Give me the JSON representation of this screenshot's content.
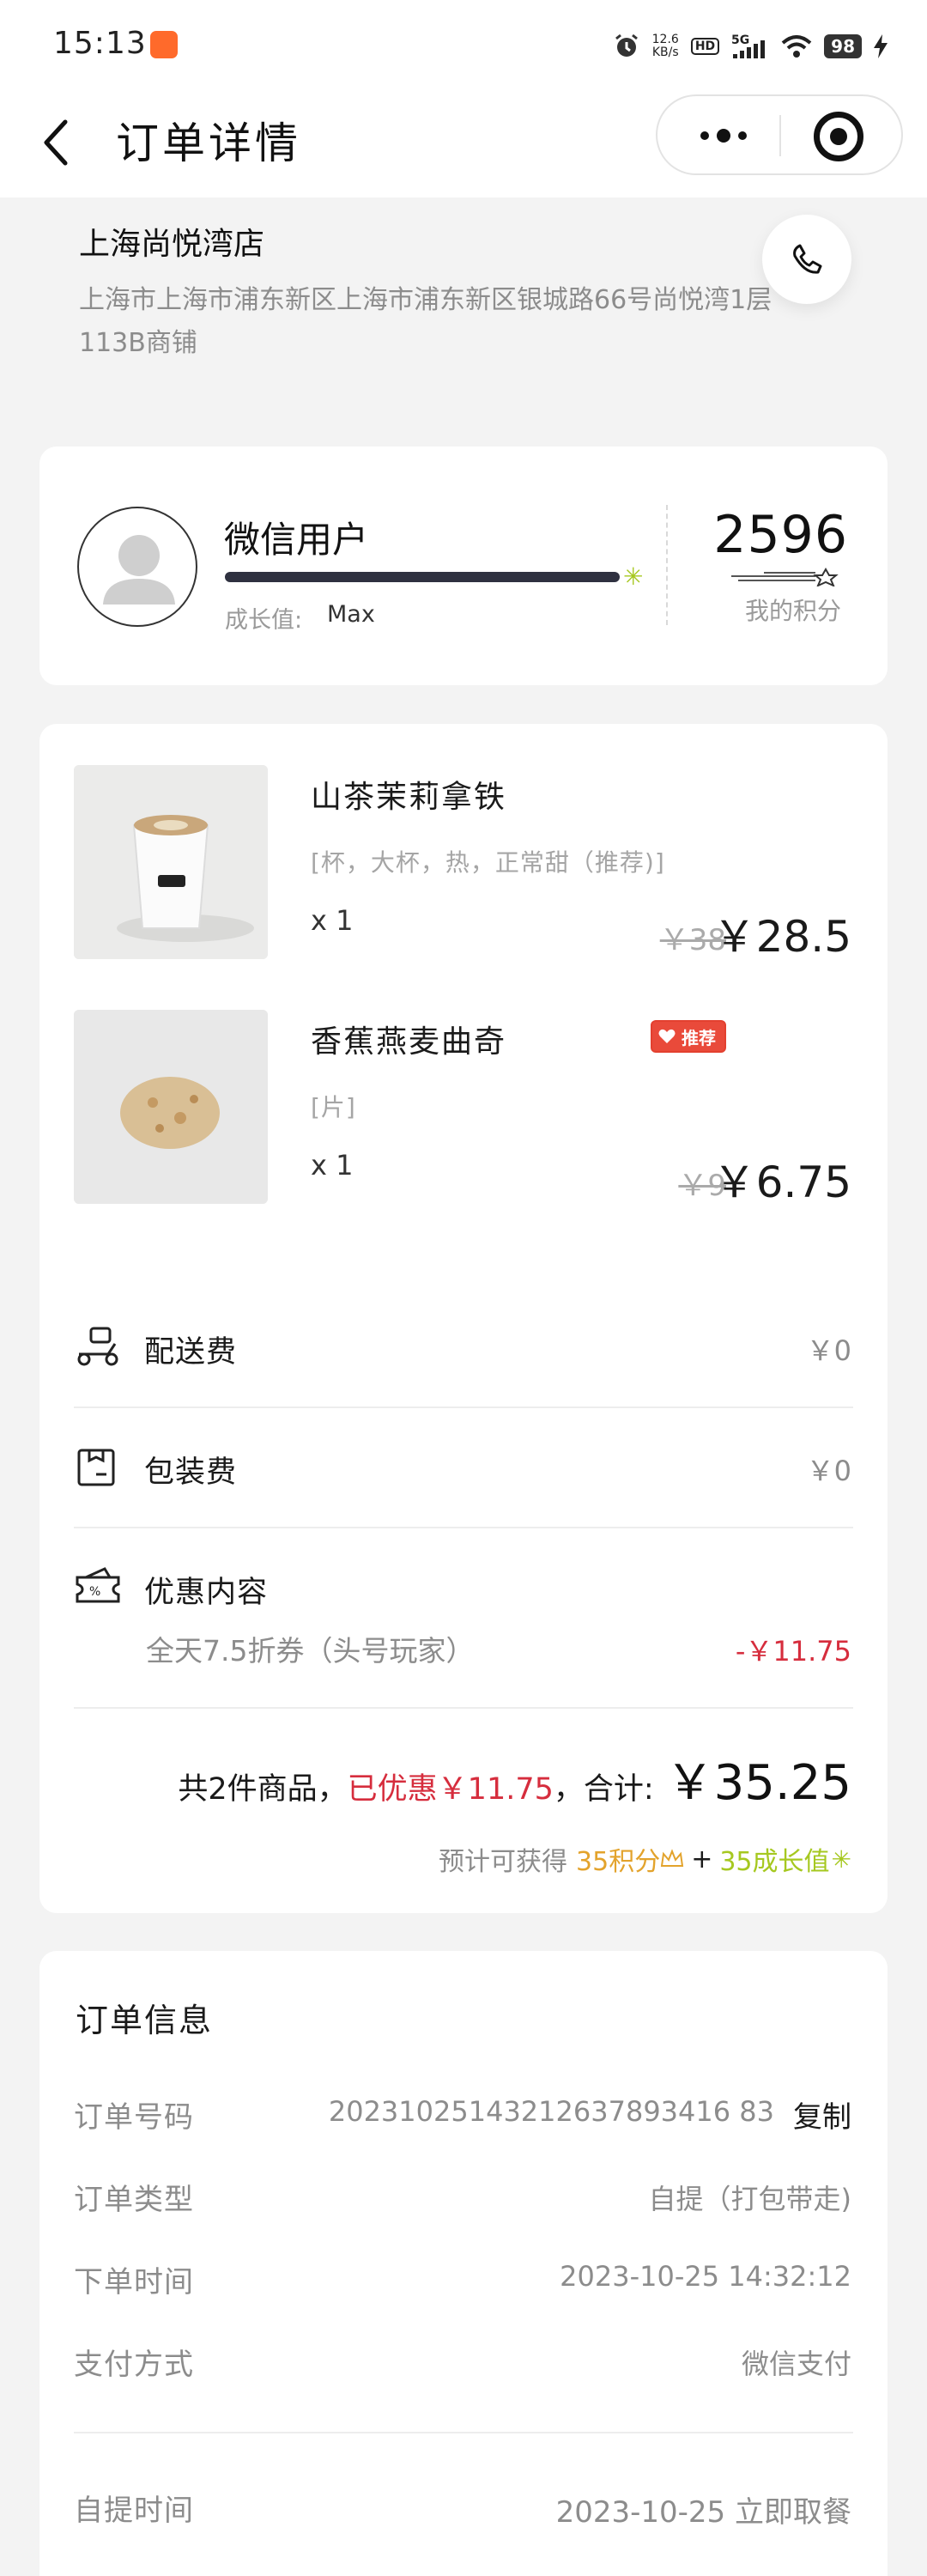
{
  "status_bar": {
    "time": "15:13",
    "speed": "12.6",
    "speed_unit": "KB/s",
    "hd": "HD",
    "network": "5G",
    "battery": "98",
    "icons": [
      "alarm-icon",
      "hd-icon",
      "signal-icon",
      "wifi-icon",
      "battery-icon",
      "charging-icon"
    ]
  },
  "nav": {
    "title": "订单详情"
  },
  "store": {
    "name": "上海尚悦湾店",
    "address": "上海市上海市浦东新区上海市浦东新区银城路66号尚悦湾1层113B商铺"
  },
  "member": {
    "name": "微信用户",
    "growth_label": "成长值:",
    "growth_value": "Max",
    "growth_progress": 1.0,
    "points": "2596",
    "points_label": "我的积分"
  },
  "items": [
    {
      "name": "山茶茉莉拿铁",
      "spec": "[杯，大杯，热，正常甜（推荐)]",
      "qty": "x 1",
      "orig_price": "￥38",
      "price": "￥28.5",
      "image": "coffee-cup-image"
    },
    {
      "name": "香蕉燕麦曲奇",
      "spec": "[片]",
      "qty": "x 1",
      "orig_price": "￥9",
      "price": "￥6.75",
      "tag": "推荐",
      "image": "cookie-image"
    }
  ],
  "fees": {
    "delivery_label": "配送费",
    "delivery_value": "￥0",
    "packing_label": "包装费",
    "packing_value": "￥0",
    "discount_label": "优惠内容",
    "discount_name": "全天7.5折券（头号玩家）",
    "discount_value": "-￥11.75"
  },
  "summary": {
    "count_text": "共2件商品，",
    "saved_text": "已优惠￥11.75",
    "sum_text": "，合计:",
    "total": "￥35.25",
    "estimate_prefix": "预计可获得",
    "estimate_points": "35积分",
    "estimate_plus": "+",
    "estimate_growth": "35成长值"
  },
  "order_info": {
    "title": "订单信息",
    "rows": [
      {
        "label": "订单号码",
        "value": "20231025143212637893416 83"
      },
      {
        "label": "订单类型",
        "value": "自提（打包带走)"
      },
      {
        "label": "下单时间",
        "value": "2023-10-25 14:32:12"
      },
      {
        "label": "支付方式",
        "value": "微信支付"
      }
    ],
    "copy_label": "复制",
    "pickup_time_label": "自提时间",
    "pickup_time_value": "2023-10-25 立即取餐"
  },
  "colors": {
    "accent_red": "#d62d3d",
    "accent_green": "#a6c820",
    "accent_orange": "#e3a32c",
    "background": "#f3f3f3"
  }
}
